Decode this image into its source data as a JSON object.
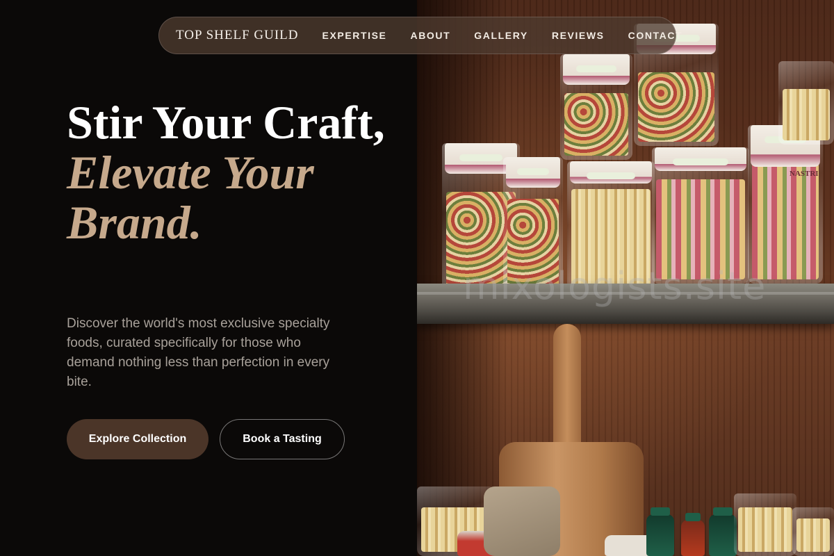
{
  "brand": {
    "name": "TOP SHELF GUILD"
  },
  "nav": {
    "links": [
      "EXPERTISE",
      "ABOUT",
      "GALLERY",
      "REVIEWS",
      "CONTACT"
    ]
  },
  "hero": {
    "title_line1": "Stir Your Craft,",
    "title_line2": "Elevate Your Brand.",
    "description": "Discover the world's most exclusive specialty foods, curated specifically for those who demand nothing less than perfection in every bite.",
    "primary_button": "Explore Collection",
    "secondary_button": "Book a Tasting"
  },
  "image": {
    "watermark": "mixologists.site",
    "label_nastri": "NASTRI"
  },
  "colors": {
    "accent": "#c6a98c",
    "nav_background": "#4e3b30",
    "primary_button": "#4b3528",
    "page_background": "#0b0908"
  }
}
